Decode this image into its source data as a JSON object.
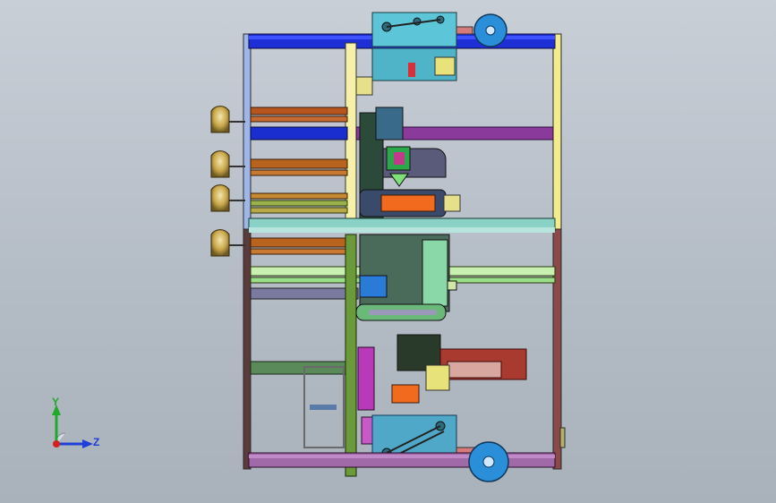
{
  "viewport": {
    "background": "#b9c0c9"
  },
  "model": {
    "frame_color": "#7a4a4a",
    "top_beam_color": "#1e2fd6",
    "panel_color": "#5cc6d8"
  },
  "triad": {
    "x_label": "Z",
    "y_label": "Y",
    "y_color": "#1faa2a",
    "z_color": "#1f3fd6",
    "origin_color": "#d61f1f"
  }
}
